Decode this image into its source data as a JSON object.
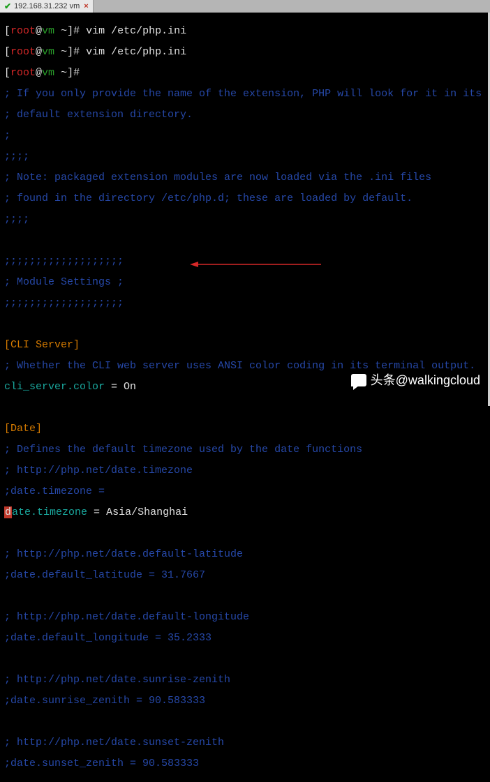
{
  "tab": {
    "label": "192.168.31.232 vm",
    "close": "×"
  },
  "prompt": {
    "open": "[",
    "user": "root",
    "at": "@",
    "host": "vm",
    "path": " ~",
    "close": "]#"
  },
  "commands": {
    "cmd1": " vim /etc/php.ini",
    "cmd2": " vim /etc/php.ini",
    "cmd3": ""
  },
  "comments": {
    "c1": "; If you only provide the name of the extension, PHP will look for it in its",
    "c2": "; default extension directory.",
    "c3": ";",
    "c4": ";;;;",
    "c5": "; Note: packaged extension modules are now loaded via the .ini files",
    "c6": "; found in the directory /etc/php.d; these are loaded by default.",
    "c7": ";;;;",
    "c8": "",
    "c9": ";;;;;;;;;;;;;;;;;;;",
    "c10": "; Module Settings ;",
    "c11": ";;;;;;;;;;;;;;;;;;;",
    "c12": "",
    "c13": "; Whether the CLI web server uses ANSI color coding in its terminal output.",
    "c14": "",
    "c15": "; Defines the default timezone used by the date functions",
    "c16": "; http://php.net/date.timezone",
    "c17": ";date.timezone =",
    "c18": "",
    "c19": "; http://php.net/date.default-latitude",
    "c20": ";date.default_latitude = 31.7667",
    "c21": "",
    "c22": "; http://php.net/date.default-longitude",
    "c23": ";date.default_longitude = 35.2333",
    "c24": "",
    "c25": "; http://php.net/date.sunrise-zenith",
    "c26": ";date.sunrise_zenith = 90.583333",
    "c27": "",
    "c28": "; http://php.net/date.sunset-zenith",
    "c29": ";date.sunset_zenith = 90.583333"
  },
  "sections": {
    "cli": "[CLI Server]",
    "date": "[Date]"
  },
  "settings": {
    "cli_color_key": "cli_server.color",
    "cli_color_eq": " = ",
    "cli_color_val": "On",
    "tz_cursor": "d",
    "tz_key_rest": "ate.timezone",
    "tz_eq": " = ",
    "tz_val": "Asia/Shanghai"
  },
  "watermark": {
    "text": "头条@walkingcloud"
  },
  "chart_data": null
}
